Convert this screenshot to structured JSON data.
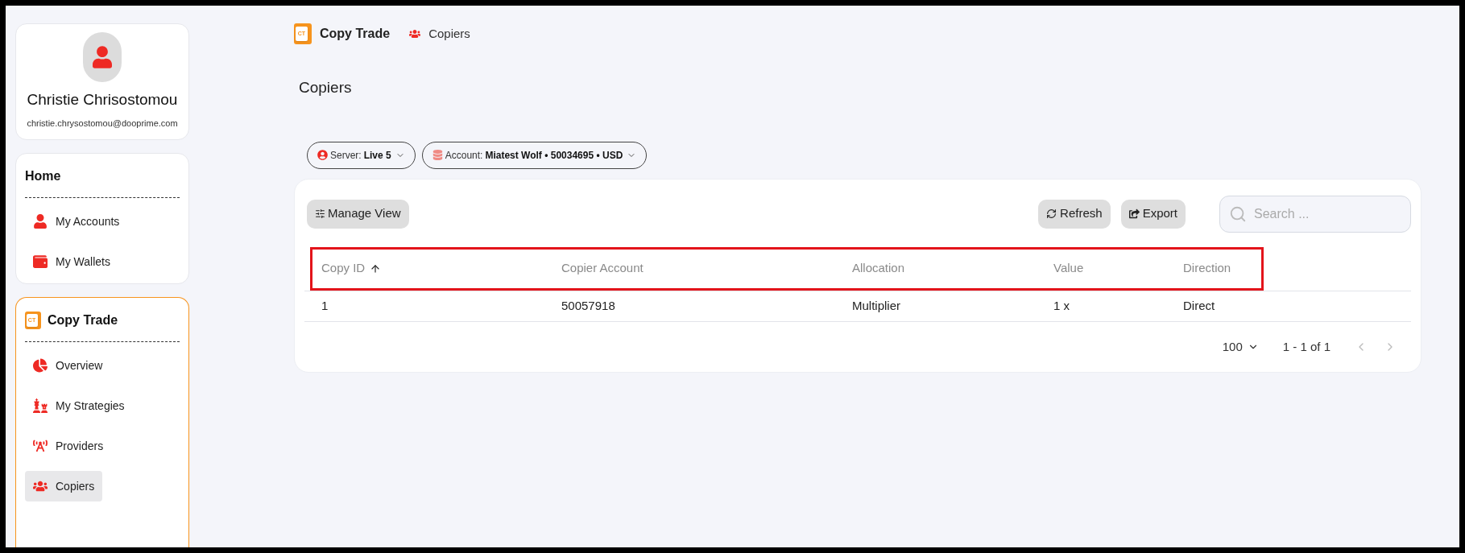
{
  "profile": {
    "name": "Christie Chrisostomou",
    "email": "christie.chrysostomou@dooprime.com"
  },
  "sidebar": [
    {
      "title": "Home",
      "kind": "plain",
      "accent": false,
      "items": [
        {
          "label": "My Accounts",
          "selected": false
        },
        {
          "label": "My Wallets",
          "selected": false
        }
      ]
    },
    {
      "title": "Copy Trade",
      "kind": "logo",
      "logo_text": "CT",
      "accent": true,
      "items": [
        {
          "label": "Overview",
          "selected": false
        },
        {
          "label": "My Strategies",
          "selected": false
        },
        {
          "label": "Providers",
          "selected": false
        },
        {
          "label": "Copiers",
          "selected": true
        }
      ]
    }
  ],
  "breadcrumb": {
    "logo_text": "CT",
    "section": "Copy Trade",
    "page": "Copiers"
  },
  "page_title": "Copiers",
  "filters": [
    {
      "kind": "server",
      "label": "Server:",
      "value": "Live 5"
    },
    {
      "kind": "account",
      "label": "Account:",
      "value": "Miatest Wolf • 50034695 • USD"
    }
  ],
  "toolbar": {
    "manage_view": "Manage View",
    "refresh": "Refresh",
    "export": "Export",
    "search": {
      "placeholder": "Search ..."
    }
  },
  "table": {
    "header_highlighted": true,
    "columns": [
      {
        "label": "Copy ID",
        "sorted": true
      },
      {
        "label": "Copier Account",
        "sorted": false
      },
      {
        "label": "Allocation",
        "sorted": false
      },
      {
        "label": "Value",
        "sorted": false
      },
      {
        "label": "Direction",
        "sorted": false
      }
    ],
    "rows": [
      [
        "1",
        "50057918",
        "Multiplier",
        "1 x",
        "Direct"
      ]
    ]
  },
  "pagination": {
    "page_size": "100",
    "range": "1 - 1 of 1",
    "prev_disabled": true,
    "next_disabled": true
  }
}
